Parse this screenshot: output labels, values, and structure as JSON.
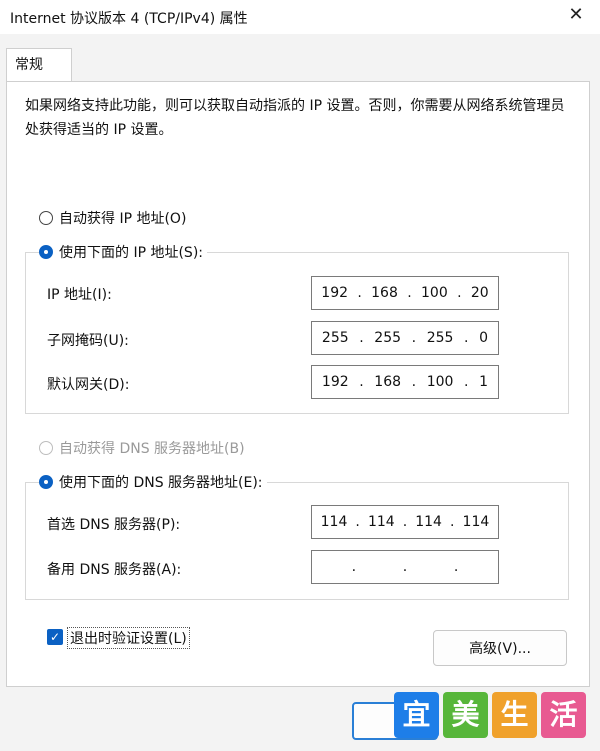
{
  "window": {
    "title": "Internet 协议版本 4 (TCP/IPv4) 属性",
    "close_glyph": "✕"
  },
  "tabs": [
    {
      "label": "常规"
    }
  ],
  "intro_text": "如果网络支持此功能，则可以获取自动指派的 IP 设置。否则，你需要从网络系统管理员处获得适当的 IP 设置。",
  "ip_section": {
    "auto_label": "自动获得 IP 地址(O)",
    "manual_label": "使用下面的 IP 地址(S):",
    "fields": [
      {
        "label": "IP 地址(I):",
        "octets": [
          "192",
          "168",
          "100",
          "20"
        ]
      },
      {
        "label": "子网掩码(U):",
        "octets": [
          "255",
          "255",
          "255",
          "0"
        ]
      },
      {
        "label": "默认网关(D):",
        "octets": [
          "192",
          "168",
          "100",
          "1"
        ]
      }
    ]
  },
  "dns_section": {
    "auto_label": "自动获得 DNS 服务器地址(B)",
    "manual_label": "使用下面的 DNS 服务器地址(E):",
    "fields": [
      {
        "label": "首选 DNS 服务器(P):",
        "octets": [
          "114",
          "114",
          "114",
          "114"
        ]
      },
      {
        "label": "备用 DNS 服务器(A):",
        "octets": [
          "",
          "",
          "",
          ""
        ]
      }
    ]
  },
  "validate_label": "退出时验证设置(L)",
  "advanced_label": "高级(V)...",
  "watermark": [
    "宜",
    "美",
    "生",
    "活"
  ],
  "colors": {
    "accent": "#0b61c3",
    "watermark": [
      "#1e7ee8",
      "#57b63a",
      "#f0a12b",
      "#e85a91"
    ]
  }
}
